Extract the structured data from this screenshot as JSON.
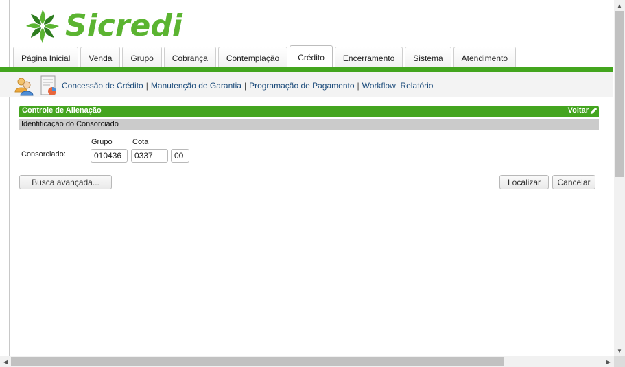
{
  "brand": {
    "name": "Sicredi",
    "color": "#5bb431",
    "accent": "#44a51f"
  },
  "tabs": [
    {
      "label": "Página Inicial",
      "active": false
    },
    {
      "label": "Venda",
      "active": false
    },
    {
      "label": "Grupo",
      "active": false
    },
    {
      "label": "Cobrança",
      "active": false
    },
    {
      "label": "Contemplação",
      "active": false
    },
    {
      "label": "Crédito",
      "active": true
    },
    {
      "label": "Encerramento",
      "active": false
    },
    {
      "label": "Sistema",
      "active": false
    },
    {
      "label": "Atendimento",
      "active": false
    }
  ],
  "subnav": {
    "links": [
      "Concessão de Crédito",
      "Manutenção de Garantia",
      "Programação de Pagamento",
      "Workflow",
      "Relatório"
    ],
    "separators": [
      "|",
      "|",
      "|"
    ]
  },
  "section": {
    "title": "Controle de Alienação",
    "back_label": "Voltar",
    "subsection_title": "Identificação do Consorciado"
  },
  "form": {
    "consorciado_label": "Consorciado:",
    "grupo_label": "Grupo",
    "cota_label": "Cota",
    "grupo_value": "010436",
    "cota_value": "0337",
    "digito_value": "00"
  },
  "buttons": {
    "advanced_search": "Busca avançada...",
    "locate": "Localizar",
    "cancel": "Cancelar"
  },
  "icons": {
    "logo": "sicredi-logo-icon",
    "users": "users-icon",
    "document": "document-icon",
    "pencil": "pencil-icon"
  }
}
